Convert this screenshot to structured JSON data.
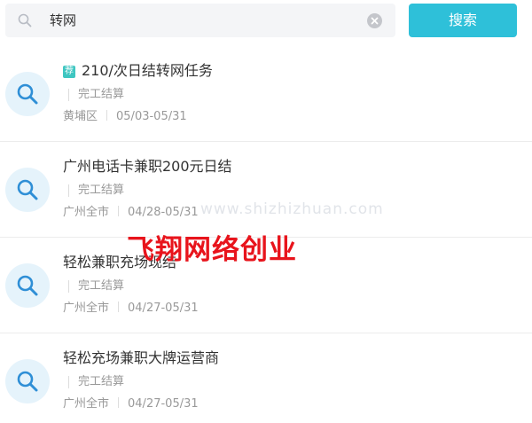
{
  "search": {
    "value": "转网",
    "button_label": "搜索"
  },
  "jobs": [
    {
      "recommended_badge": "荐",
      "title": "210/次日结转网任务",
      "settlement": "完工结算",
      "location": "黄埔区",
      "date_range": "05/03-05/31"
    },
    {
      "title": "广州电话卡兼职200元日结",
      "settlement": "完工结算",
      "location": "广州全市",
      "date_range": "04/28-05/31"
    },
    {
      "title": "轻松兼职充场现结",
      "settlement": "完工结算",
      "location": "广州全市",
      "date_range": "04/27-05/31"
    },
    {
      "title": "轻松充场兼职大牌运营商",
      "settlement": "完工结算",
      "location": "广州全市",
      "date_range": "04/27-05/31"
    }
  ],
  "watermark": {
    "url": "www.shizhizhuan.com",
    "brand": "飞翔网络创业"
  },
  "colors": {
    "accent": "#2ec0d9",
    "badge": "#3ec6c1",
    "brand_red": "#e8141c",
    "icon_bg": "#e5f3fb",
    "icon_stroke": "#2f8fd6"
  }
}
